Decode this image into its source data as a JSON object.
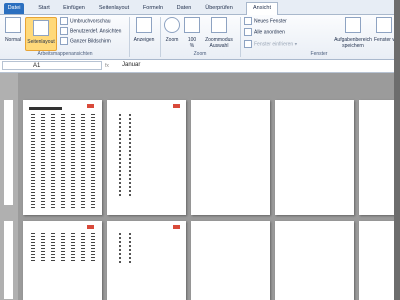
{
  "tabs": [
    {
      "key": "file",
      "label": "Datei"
    },
    {
      "key": "start",
      "label": "Start"
    },
    {
      "key": "insert",
      "label": "Einfügen"
    },
    {
      "key": "layout",
      "label": "Seitenlayout"
    },
    {
      "key": "formulas",
      "label": "Formeln"
    },
    {
      "key": "data",
      "label": "Daten"
    },
    {
      "key": "review",
      "label": "Überprüfen"
    },
    {
      "key": "view",
      "label": "Ansicht"
    }
  ],
  "ribbon": {
    "workbook_views": {
      "normal": "Normal",
      "page_layout": "Seitenlayout",
      "page_break": "Umbruchvorschau",
      "custom_views": "Benutzerdef. Ansichten",
      "full_screen": "Ganzer Bildschirm",
      "group_label": "Arbeitsmappenansichten"
    },
    "show": {
      "label": "Anzeigen"
    },
    "zoom": {
      "zoom": "Zoom",
      "hundred": "100\n%",
      "selection": "Zoommodus Auswahl",
      "group_label": "Zoom"
    },
    "window": {
      "new_window": "Neues Fenster",
      "arrange_all": "Alle anordnen",
      "freeze_panes": "Fenster einfrieren",
      "save_workspace": "Aufgabenbereich speichern",
      "switch_windows": "Fenster wechseln",
      "group_label": "Fenster"
    }
  },
  "formula_bar": {
    "cell_ref": "A1",
    "fx": "fx",
    "content": "Januar"
  }
}
